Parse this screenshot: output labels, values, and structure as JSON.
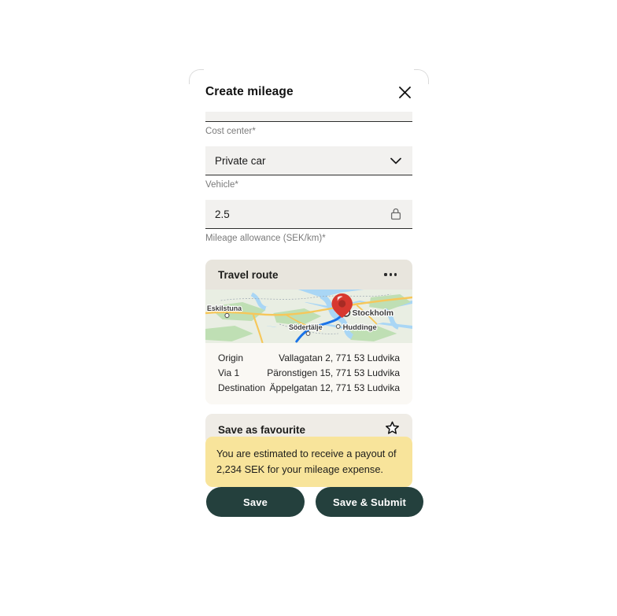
{
  "dialog": {
    "title": "Create mileage",
    "close_icon": "close-icon"
  },
  "form": {
    "fields": [
      {
        "value": "",
        "label": "Cost center*",
        "icon": "",
        "clipped": true
      },
      {
        "value": "Private car",
        "label": "Vehicle*",
        "icon": "chevron-down-icon",
        "clipped": false
      },
      {
        "value": "2.5",
        "label": "Mileage allowance (SEK/km)*",
        "icon": "lock-icon",
        "clipped": false
      }
    ]
  },
  "route_card": {
    "header_title": "Travel route",
    "menu_icon": "ellipsis-icon",
    "map": {
      "pin_icon": "map-pin-icon",
      "labels": [
        "Eskilstuna",
        "Stockholm",
        "Södertälje",
        "Huddinge"
      ],
      "colors": {
        "water": "#a9d6f5",
        "land": "#e9eee3",
        "forest": "#bfdfb4",
        "road": "#f6c75a",
        "route": "#1a73e8",
        "pin": "#d7382f"
      }
    },
    "rows": [
      {
        "label": "Origin",
        "value": "Vallagatan 2, 771 53 Ludvika"
      },
      {
        "label": "Via 1",
        "value": "Päronstigen 15, 771 53 Ludvika"
      },
      {
        "label": "Destination",
        "value": "Äppelgatan 12, 771 53 Ludvika"
      }
    ]
  },
  "favourite": {
    "label": "Save as favourite",
    "icon": "star-outline-icon"
  },
  "payout": {
    "text": "You are estimated to receive a payout of 2,234 SEK for your mileage expense.",
    "background": "#f8e49b"
  },
  "actions": {
    "save_label": "Save",
    "save_submit_label": "Save & Submit",
    "color": "#24403d"
  }
}
